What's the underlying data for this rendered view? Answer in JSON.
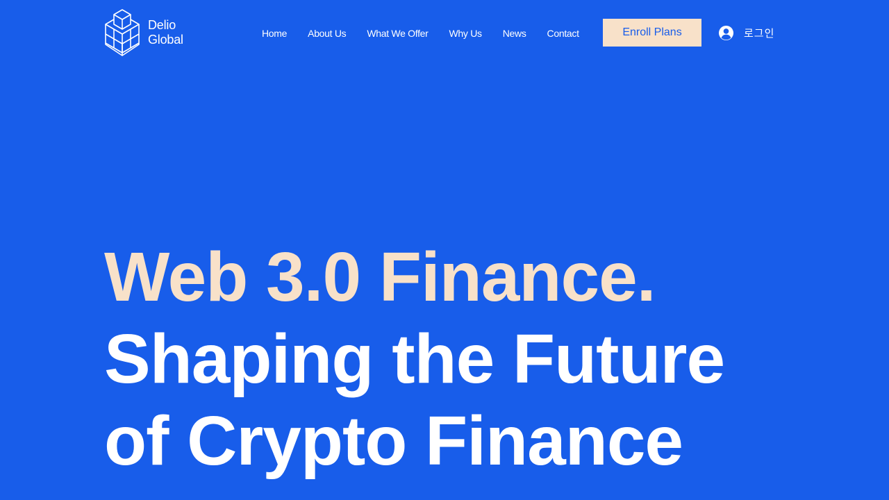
{
  "brand": {
    "name_line1": "Delio",
    "name_line2": "Global",
    "logo_icon": "stacked-cubes-logo"
  },
  "nav": {
    "items": [
      {
        "label": "Home"
      },
      {
        "label": "About Us"
      },
      {
        "label": "What We Offer"
      },
      {
        "label": "Why Us"
      },
      {
        "label": "News"
      },
      {
        "label": "Contact"
      }
    ]
  },
  "header": {
    "enroll_label": "Enroll Plans",
    "login_label": "로그인",
    "login_icon": "user-circle-icon"
  },
  "hero": {
    "line1": "Web 3.0 Finance.",
    "line2": "Shaping the Future",
    "line3": "of Crypto Finance"
  },
  "colors": {
    "background": "#185DEA",
    "accent": "#F8E1C9",
    "text": "#FFFFFF"
  }
}
